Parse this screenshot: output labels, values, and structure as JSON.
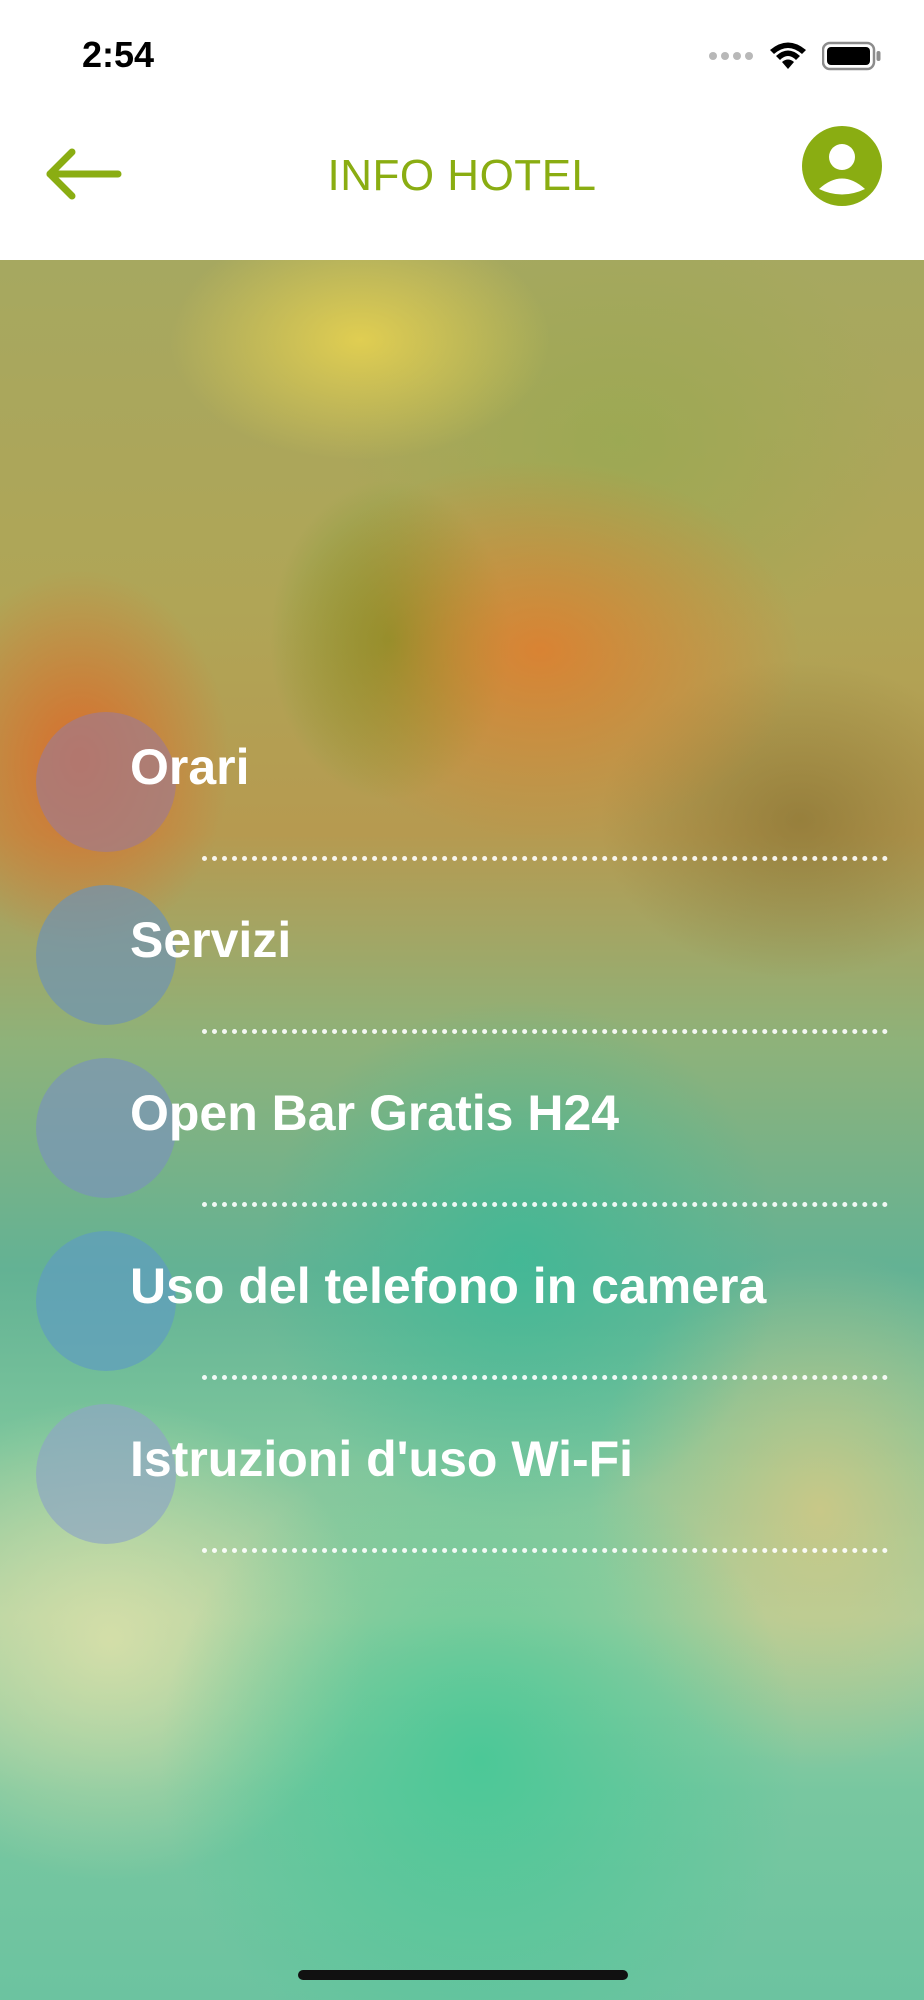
{
  "status_bar": {
    "time": "2:54",
    "icons": [
      "signal-icon",
      "wifi-icon",
      "battery-icon"
    ]
  },
  "header": {
    "title": "INFO HOTEL",
    "back_icon": "back-arrow-icon",
    "profile_icon": "user-profile-icon"
  },
  "colors": {
    "accent": "#8aad12",
    "menu_text": "#ffffff"
  },
  "menu": {
    "items": [
      {
        "label": "Orari",
        "bubble_color": "#a37a8a"
      },
      {
        "label": "Servizi",
        "bubble_color": "#6f93b3"
      },
      {
        "label": "Open Bar Gratis H24",
        "bubble_color": "#7a94b9"
      },
      {
        "label": "Uso del telefono in camera",
        "bubble_color": "#5f9cc0"
      },
      {
        "label": "Istruzioni d'uso Wi-Fi",
        "bubble_color": "#8ea6c3"
      }
    ]
  }
}
